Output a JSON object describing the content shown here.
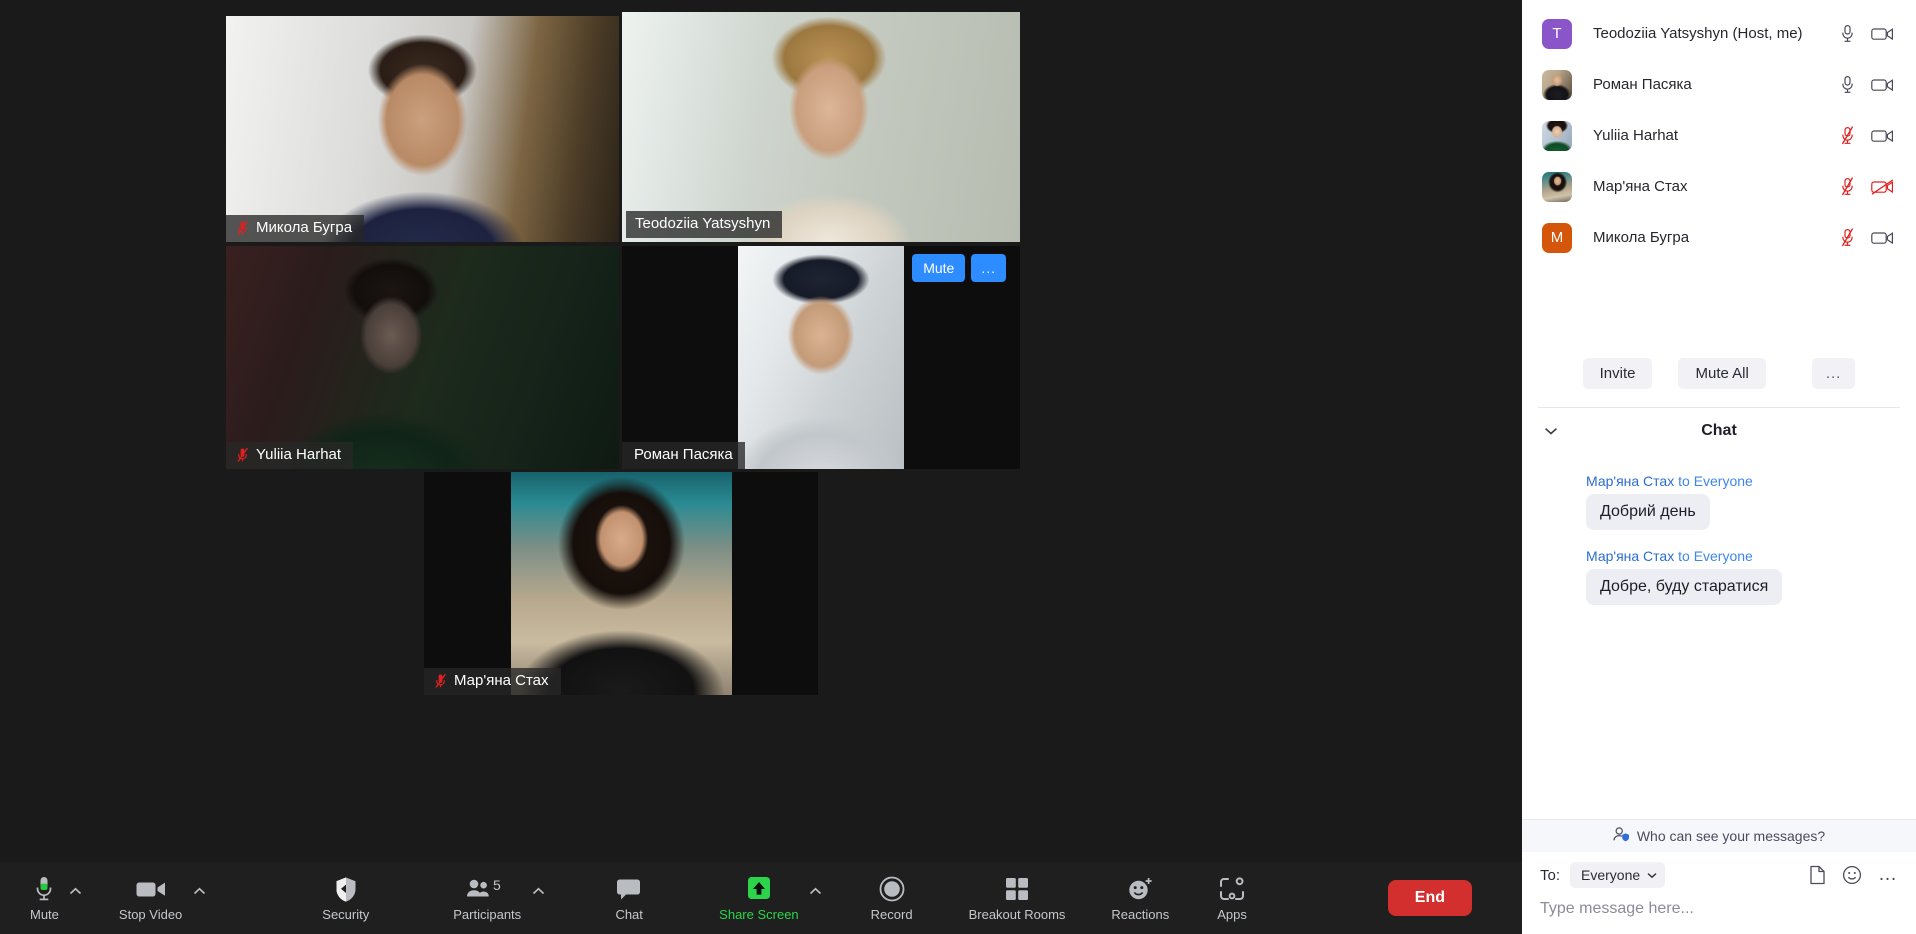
{
  "meeting": {
    "active_speaker": "Teodoziia Yatsyshyn"
  },
  "video_tiles": [
    {
      "name": "Микола Бугра",
      "muted": true,
      "active": false,
      "video_class": "v-mykola"
    },
    {
      "name": "Teodoziia Yatsyshyn",
      "muted": false,
      "active": true,
      "video_class": "v-teo"
    },
    {
      "name": "Yuliia Harhat",
      "muted": true,
      "active": false,
      "video_class": "v-yuliia"
    },
    {
      "name": "Роман Пасяка",
      "muted": false,
      "active": false,
      "video_class": "v-roman"
    },
    {
      "name": "Мар'яна Стах",
      "muted": true,
      "active": false,
      "video_class": "v-maryana"
    }
  ],
  "tile_hover_controls": {
    "mute_label": "Mute",
    "more_label": "..."
  },
  "participants": {
    "items": [
      {
        "name": "Teodoziia Yatsyshyn (Host, me)",
        "avatar_kind": "initial-t",
        "avatar_text": "T",
        "mic_muted": false,
        "video_off": false
      },
      {
        "name": "Роман Пасяка",
        "avatar_kind": "ph-roman",
        "avatar_text": "",
        "mic_muted": false,
        "video_off": false
      },
      {
        "name": "Yuliia Harhat",
        "avatar_kind": "ph-yuliia",
        "avatar_text": "",
        "mic_muted": true,
        "video_off": false
      },
      {
        "name": "Мар'яна Стах",
        "avatar_kind": "ph-maryana",
        "avatar_text": "",
        "mic_muted": true,
        "video_off": true
      },
      {
        "name": "Микола Бугра",
        "avatar_kind": "initial-m",
        "avatar_text": "M",
        "mic_muted": true,
        "video_off": false
      }
    ],
    "invite_label": "Invite",
    "mute_all_label": "Mute All",
    "more_label": "..."
  },
  "chat": {
    "title": "Chat",
    "messages": [
      {
        "from": "Мар'яна Стах",
        "to_word": "to",
        "to": "Everyone",
        "text": "Добрий день",
        "avatar_kind": "ph-maryana"
      },
      {
        "from": "Мар'яна Стах",
        "to_word": "to",
        "to": "Everyone",
        "text": "Добре, буду старатися",
        "avatar_kind": "ph-maryana"
      }
    ],
    "who_can_see": "Who can see your messages?",
    "to_label": "To:",
    "to_value": "Everyone",
    "input_placeholder": "Type message here...",
    "input_value": ""
  },
  "toolbar": {
    "mute": "Mute",
    "stop_video": "Stop Video",
    "security": "Security",
    "participants": "Participants",
    "participants_count": "5",
    "chat": "Chat",
    "share_screen": "Share Screen",
    "record": "Record",
    "breakout_rooms": "Breakout Rooms",
    "reactions": "Reactions",
    "apps": "Apps",
    "end": "End"
  },
  "colors": {
    "accent_blue": "#2d8cff",
    "active_speaker_border": "#e7f04f",
    "share_green": "#2bd44b",
    "end_red": "#d32f2f",
    "mute_red": "#e02020",
    "panel_bg": "#ffffff",
    "stage_bg": "#1a1a1a"
  }
}
